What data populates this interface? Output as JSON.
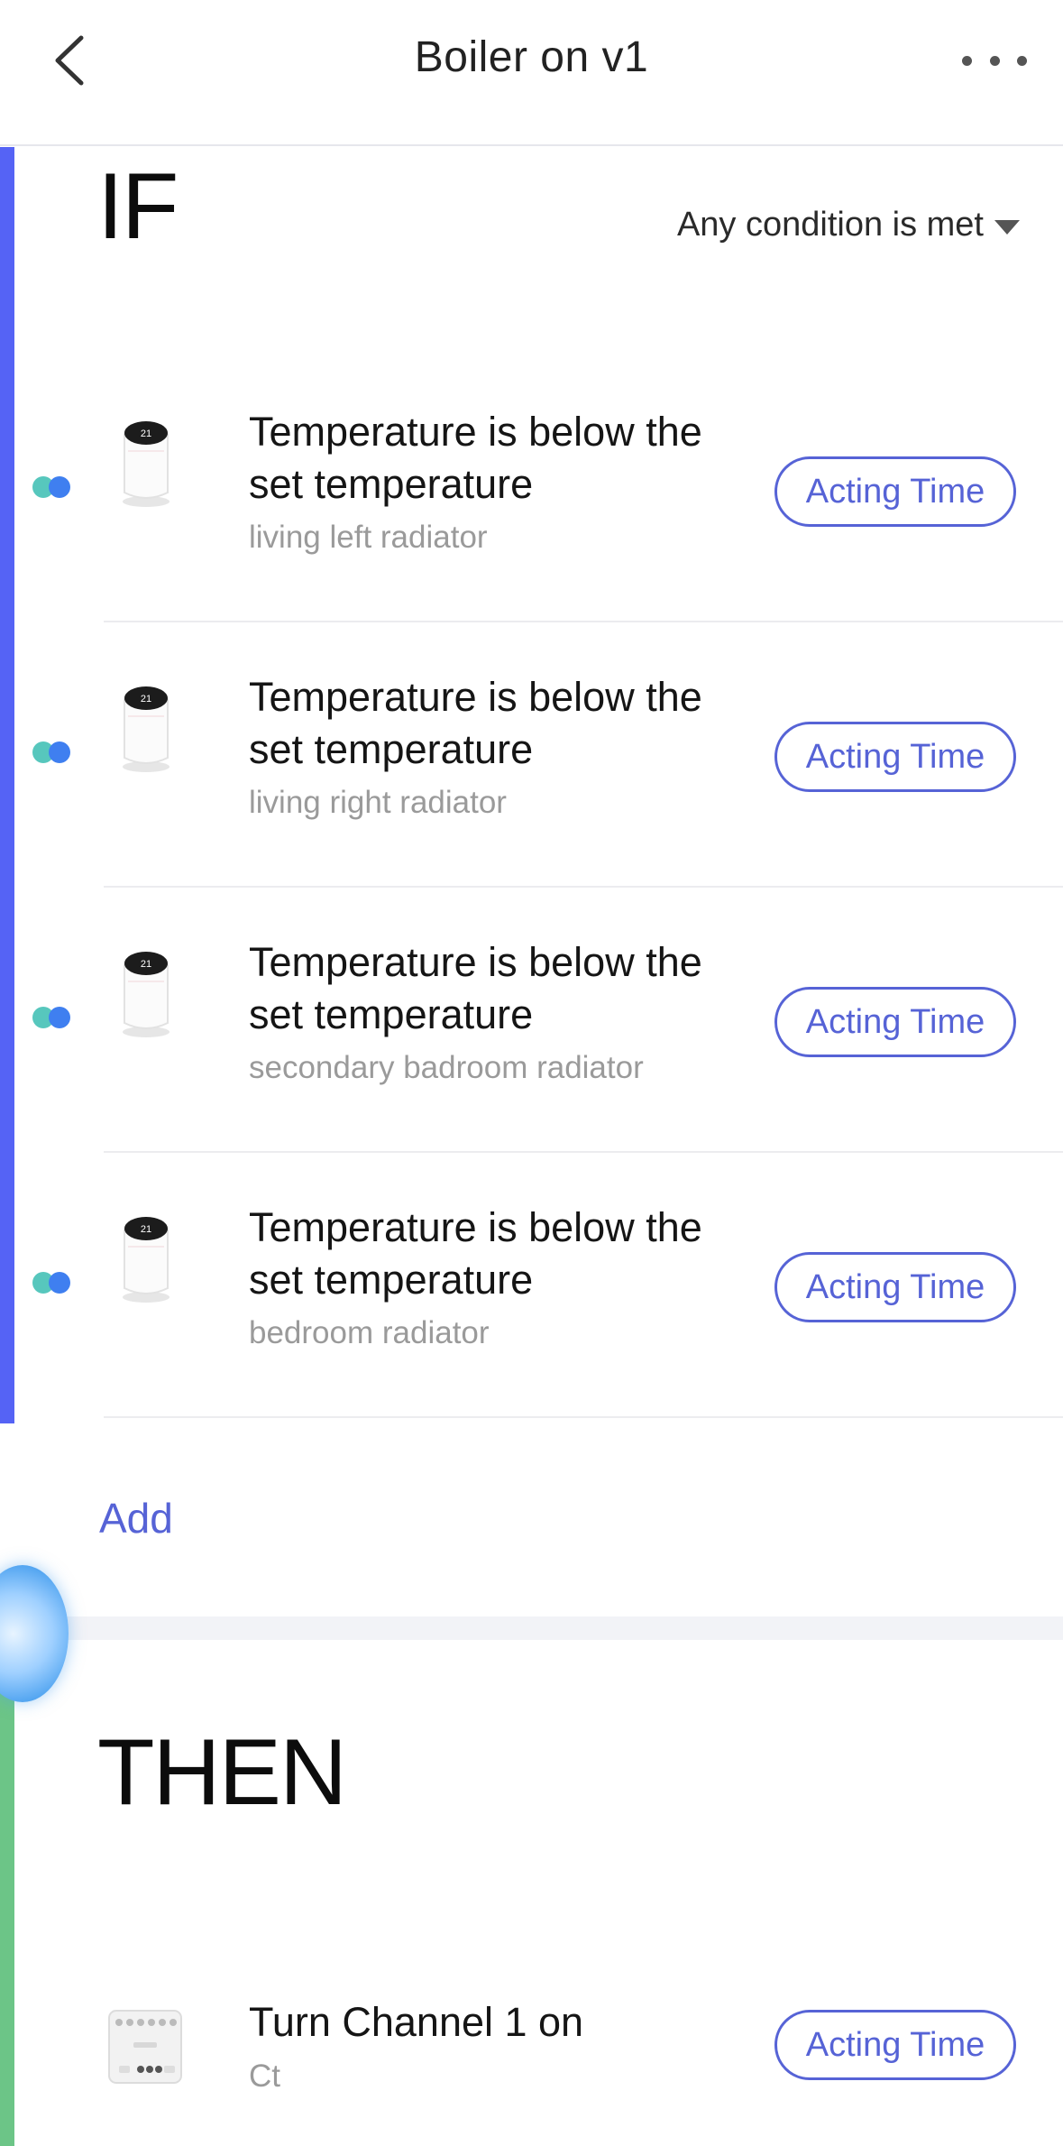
{
  "header": {
    "title": "Boiler on v1"
  },
  "if_section": {
    "label": "IF",
    "condition_mode": "Any condition is met",
    "conditions": [
      {
        "title": "Temperature is below the set temperature",
        "device": "living left radiator",
        "button": "Acting Time"
      },
      {
        "title": "Temperature is below the set temperature",
        "device": "living right radiator",
        "button": "Acting Time"
      },
      {
        "title": "Temperature is below the set temperature",
        "device": "secondary badroom radiator",
        "button": "Acting Time"
      },
      {
        "title": "Temperature is below the set temperature",
        "device": "bedroom radiator",
        "button": "Acting Time"
      }
    ],
    "add_label": "Add"
  },
  "then_section": {
    "label": "THEN",
    "actions": [
      {
        "title": "Turn Channel 1 on",
        "device": "Ct",
        "button": "Acting Time"
      }
    ]
  },
  "colors": {
    "accent": "#5663d6",
    "if_bar": "#5563f5",
    "then_bar": "#6cc587",
    "dot_teal": "#57c7bd",
    "dot_blue": "#3f7ff0"
  },
  "icons": {
    "back": "chevron-left-icon",
    "more": "more-horizontal-icon",
    "mode_dropdown": "triangle-down-icon",
    "radiator_device": "thermostat-valve-icon",
    "relay_device": "relay-module-icon"
  }
}
